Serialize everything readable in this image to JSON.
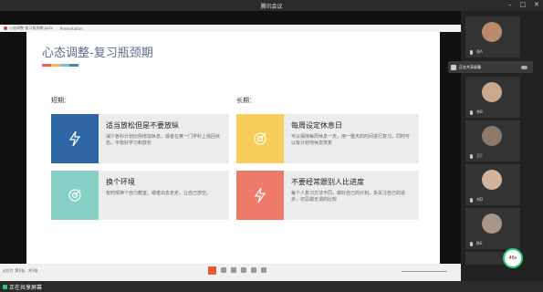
{
  "window": {
    "title": "腾讯会议"
  },
  "ppt_tabs": [
    {
      "label": "心态调整-复习瓶颈期.pptx"
    },
    {
      "label": "Presentation"
    }
  ],
  "slide": {
    "title": "心态调整-复习瓶颈期",
    "title_bar_colors": [
      "#e8615a",
      "#f5b84a",
      "#6ec6d0",
      "#4a7fb5"
    ],
    "short_term": {
      "label": "短期：",
      "cards": [
        {
          "title": "适当放松但是不要放纵",
          "desc": "减少各科计划比例增加休息，或者在某一门学科上找回状态，平衡好学习和放松",
          "icon": "lightning-icon",
          "color": "#2f66a5"
        },
        {
          "title": "换个环境",
          "desc": "有时候换个自习教室，或者出去走走，让自己放空。",
          "icon": "target-icon",
          "color": "#86cfc4"
        }
      ]
    },
    "long_term": {
      "label": "长期：",
      "cards": [
        {
          "title": "每周设定休息日",
          "desc": "可以保持每周休息一天，用一整天的时间进行复习，同时可以有计划地休息恢复",
          "icon": "target-icon",
          "color": "#f6cd58"
        },
        {
          "title": "不要经常跟别人比进度",
          "desc": "每个人复习方法不同，做好自己的计划，多关注自己的进步，切忌做无谓的比较",
          "icon": "lightning-icon",
          "color": "#ee7a6a"
        }
      ]
    }
  },
  "status": {
    "text": "幻灯片 第1张，共1张"
  },
  "participants": [
    {
      "name": "张A",
      "avatar_color": "#b98b6a"
    },
    {
      "name": "李B",
      "avatar_color": "#c9a88e"
    },
    {
      "name": "王C",
      "avatar_color": "#8f7a6a"
    },
    {
      "name": "刘D",
      "avatar_color": "#d1b49d"
    },
    {
      "name": "陈E",
      "avatar_color": "#a89786"
    }
  ],
  "popover": {
    "label": "正在共享屏幕"
  },
  "bottom": {
    "screen_share_label": "正在共享屏幕"
  },
  "speech_indicator": {
    "value": "46s"
  }
}
